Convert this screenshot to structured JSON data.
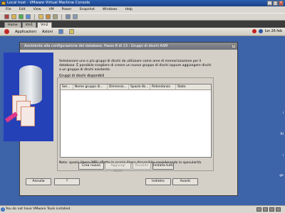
{
  "host": {
    "title": "Local host - VMware Virtual Machine Console",
    "menu": [
      "File",
      "Edit",
      "View",
      "VM",
      "Power",
      "Snapshot",
      "Windows",
      "Help"
    ],
    "tabs": [
      {
        "label": "Home"
      },
      {
        "label": "Vm1"
      },
      {
        "label": "Vm2"
      }
    ],
    "status_text": "You do not have VMware Tools installed.",
    "win_buttons": {
      "min": "_",
      "max": "□",
      "close": "×"
    }
  },
  "guest": {
    "panel": {
      "applications": "Applicazioni",
      "actions": "Azioni",
      "clock": "lun 26 feb"
    },
    "desktop_labels": [
      {
        "text": "i"
      },
      {
        "text": "Rl"
      },
      {
        "text": "i"
      },
      {
        "text": "ge"
      }
    ],
    "dialog_close": "×"
  },
  "wizard": {
    "title": "Assistente alla configurazione del database, Passo 8 di 13 : Gruppi di dischi ASM",
    "intro": "Selezionare uno o più gruppi di dischi da utilizzare come aree di memorizzazione per il database. È possibile scegliere di creare un nuovo gruppo di dischi oppure aggiungere dischi a un gruppo di dischi esistente.",
    "group_label": "Gruppi di dischi disponibili",
    "columns": [
      "Sel...",
      "Nome gruppo di...",
      "Dimensio...",
      "Spazio lib...",
      "Ridondanza",
      "Stato"
    ],
    "note": "Nota: spazio libero (MB) riflette lo spazio libero disponibile considerando la specularità.",
    "buttons": {
      "create": "Crea nuovo",
      "add_disks": "Aggiungi dischi",
      "refresh": "Rivalida",
      "install": "Installa tutti"
    },
    "footer": {
      "cancel": "Annulla",
      "help": "?",
      "back": "Indietro",
      "next": "Avanti"
    }
  }
}
